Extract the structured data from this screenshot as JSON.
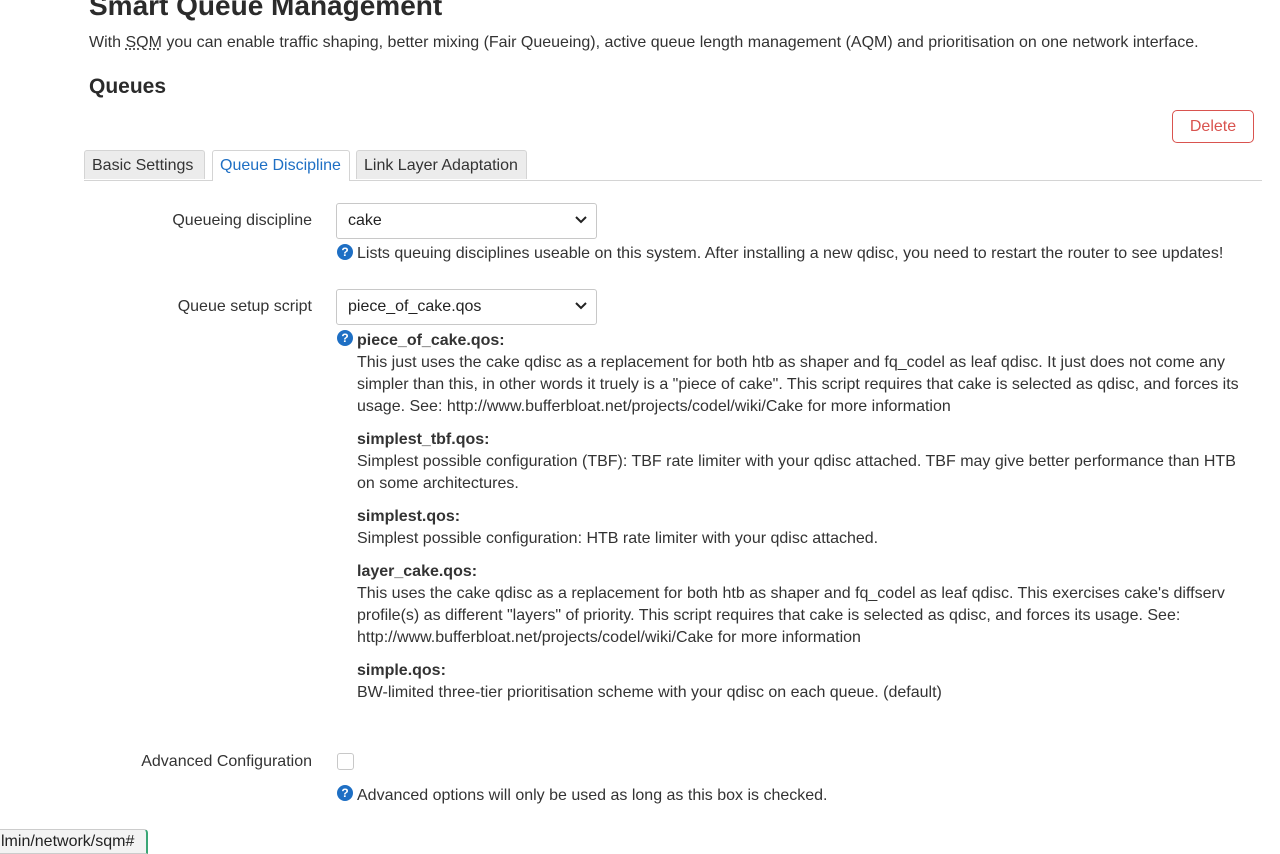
{
  "page": {
    "title": "Smart Queue Management",
    "intro_before": "With ",
    "intro_abbr": "SQM",
    "intro_after": " you can enable traffic shaping, better mixing (Fair Queueing), active queue length management (AQM) and prioritisation on one network interface.",
    "section_title": "Queues",
    "delete_label": "Delete"
  },
  "tabs": [
    {
      "label": "Basic Settings",
      "active": false
    },
    {
      "label": "Queue Discipline",
      "active": true
    },
    {
      "label": "Link Layer Adaptation",
      "active": false
    }
  ],
  "queueing_discipline": {
    "label": "Queueing discipline",
    "value": "cake",
    "help": "Lists queuing disciplines useable on this system. After installing a new qdisc, you need to restart the router to see updates!"
  },
  "queue_setup_script": {
    "label": "Queue setup script",
    "value": "piece_of_cake.qos",
    "scripts": [
      {
        "name": "piece_of_cake.qos:",
        "desc": "This just uses the cake qdisc as a replacement for both htb as shaper and fq_codel as leaf qdisc. It just does not come any simpler than this, in other words it truely is a \"piece of cake\". This script requires that cake is selected as qdisc, and forces its usage. See: http://www.bufferbloat.net/projects/codel/wiki/Cake for more information"
      },
      {
        "name": "simplest_tbf.qos:",
        "desc": "Simplest possible configuration (TBF): TBF rate limiter with your qdisc attached. TBF may give better performance than HTB on some architectures."
      },
      {
        "name": "simplest.qos:",
        "desc": "Simplest possible configuration: HTB rate limiter with your qdisc attached."
      },
      {
        "name": "layer_cake.qos:",
        "desc": "This uses the cake qdisc as a replacement for both htb as shaper and fq_codel as leaf qdisc. This exercises cake's diffserv profile(s) as different \"layers\" of priority. This script requires that cake is selected as qdisc, and forces its usage. See: http://www.bufferbloat.net/projects/codel/wiki/Cake for more information"
      },
      {
        "name": "simple.qos:",
        "desc": "BW-limited three-tier prioritisation scheme with your qdisc on each queue. (default)"
      }
    ]
  },
  "advanced": {
    "label": "Advanced Configuration",
    "checked": false,
    "help": "Advanced options will only be used as long as this box is checked."
  },
  "status_bar": {
    "url": "lmin/network/sqm#"
  },
  "icons": {
    "help": "help-icon",
    "select_arrow": "chevron-down-icon"
  },
  "colors": {
    "accent": "#1e6fc4",
    "danger": "#d9534f"
  }
}
